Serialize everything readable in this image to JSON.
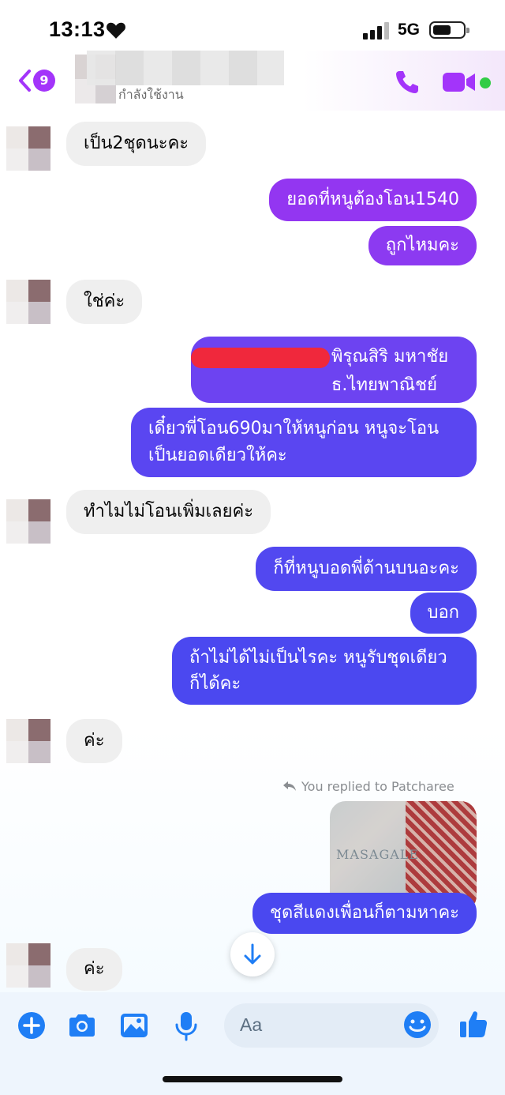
{
  "status_bar": {
    "time": "13:13",
    "network": "5G"
  },
  "header": {
    "back_badge": "9",
    "status": "กำลังใช้งาน"
  },
  "colors": {
    "accent": "#a334fa",
    "out_bubble_top": "#9736f0",
    "out_bubble_bottom": "#4a48f0",
    "in_bubble": "#efefef",
    "online": "#31cc46"
  },
  "messages": [
    {
      "side": "in",
      "text": "เป็น2ชุดนะคะ"
    },
    {
      "side": "out",
      "text": "ยอดที่หนูต้องโอน1540"
    },
    {
      "side": "out",
      "text": "ถูกไหมคะ"
    },
    {
      "side": "in",
      "text": "ใช่ค่ะ"
    },
    {
      "side": "out",
      "text": "พิรุณสิริ มหาชัย ธ.ไทยพาณิชย์"
    },
    {
      "side": "out",
      "text": "เดี๋ยวพี่โอน690มาให้หนูก่อน หนูจะโอนเป็นยอดเดียวให้คะ"
    },
    {
      "side": "in",
      "text": "ทำไมไม่โอนเพิ่มเลยค่ะ"
    },
    {
      "side": "out",
      "text": "ก็ที่หนูบอดพี่ด้านบนอะคะ"
    },
    {
      "side": "out",
      "text": "บอก"
    },
    {
      "side": "out",
      "text": "ถ้าไม่ได้ไม่เป็นไรคะ หนูรับชุดเดียวก็ได้คะ"
    },
    {
      "side": "in",
      "text": "ค่ะ"
    },
    {
      "side": "out",
      "text": "ชุดสีแดงเพื่อนก็ตามหาคะ"
    },
    {
      "side": "in",
      "text": "ค่ะ"
    }
  ],
  "reply_note": "You replied to Patcharee",
  "photo": {
    "caption_text": "MASAGALE"
  },
  "composer": {
    "placeholder": "Aa"
  },
  "icons": [
    "heart-icon",
    "signal-icon",
    "battery-icon",
    "back-chevron-icon",
    "phone-icon",
    "video-camera-icon",
    "reply-arrow-icon",
    "arrow-down-icon",
    "plus-icon",
    "camera-icon",
    "gallery-icon",
    "microphone-icon",
    "emoji-icon",
    "thumbs-up-icon"
  ]
}
